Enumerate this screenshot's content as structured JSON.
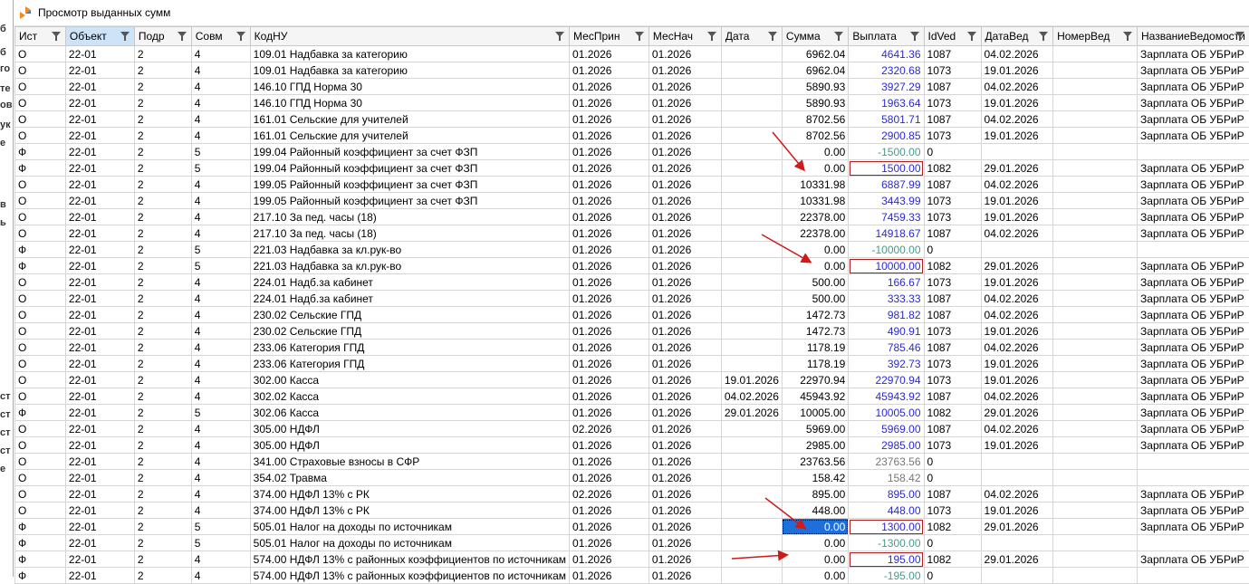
{
  "window": {
    "title": "Просмотр выданных сумм",
    "left_strip_letters": [
      "б",
      "б",
      "го",
      "те",
      "ов",
      "ук",
      "е",
      "в",
      "ь",
      "ст",
      "ст",
      "ст",
      "ст",
      "е"
    ]
  },
  "columns": [
    "Ист",
    "Объект",
    "Подр",
    "Совм",
    "КодНУ",
    "МесПрин",
    "МесНач",
    "Дата",
    "Сумма",
    "Выплата",
    "IdVed",
    "ДатаВед",
    "НомерВед",
    "НазваниеВедомости"
  ],
  "rows": [
    {
      "ist": "О",
      "obj": "22-01",
      "podr": "2",
      "sovm": "4",
      "kod": "109.01 Надбавка за категорию",
      "mesprin": "01.2026",
      "mesnach": "01.2026",
      "data": "",
      "summa": "6962.04",
      "vyplata": "4641.36",
      "idved": "1087",
      "dataved": "04.02.2026",
      "nomer": "",
      "nazv": "Зарплата ОБ УБРиР"
    },
    {
      "ist": "О",
      "obj": "22-01",
      "podr": "2",
      "sovm": "4",
      "kod": "109.01 Надбавка за категорию",
      "mesprin": "01.2026",
      "mesnach": "01.2026",
      "data": "",
      "summa": "6962.04",
      "vyplata": "2320.68",
      "idved": "1073",
      "dataved": "19.01.2026",
      "nomer": "",
      "nazv": "Зарплата ОБ УБРиР"
    },
    {
      "ist": "О",
      "obj": "22-01",
      "podr": "2",
      "sovm": "4",
      "kod": "146.10 ГПД Норма 30",
      "mesprin": "01.2026",
      "mesnach": "01.2026",
      "data": "",
      "summa": "5890.93",
      "vyplata": "3927.29",
      "idved": "1087",
      "dataved": "04.02.2026",
      "nomer": "",
      "nazv": "Зарплата ОБ УБРиР"
    },
    {
      "ist": "О",
      "obj": "22-01",
      "podr": "2",
      "sovm": "4",
      "kod": "146.10 ГПД Норма 30",
      "mesprin": "01.2026",
      "mesnach": "01.2026",
      "data": "",
      "summa": "5890.93",
      "vyplata": "1963.64",
      "idved": "1073",
      "dataved": "19.01.2026",
      "nomer": "",
      "nazv": "Зарплата ОБ УБРиР"
    },
    {
      "ist": "О",
      "obj": "22-01",
      "podr": "2",
      "sovm": "4",
      "kod": "161.01 Сельские для учителей",
      "mesprin": "01.2026",
      "mesnach": "01.2026",
      "data": "",
      "summa": "8702.56",
      "vyplata": "5801.71",
      "idved": "1087",
      "dataved": "04.02.2026",
      "nomer": "",
      "nazv": "Зарплата ОБ УБРиР"
    },
    {
      "ist": "О",
      "obj": "22-01",
      "podr": "2",
      "sovm": "4",
      "kod": "161.01 Сельские для учителей",
      "mesprin": "01.2026",
      "mesnach": "01.2026",
      "data": "",
      "summa": "8702.56",
      "vyplata": "2900.85",
      "idved": "1073",
      "dataved": "19.01.2026",
      "nomer": "",
      "nazv": "Зарплата ОБ УБРиР"
    },
    {
      "ist": "Ф",
      "obj": "22-01",
      "podr": "2",
      "sovm": "5",
      "kod": "199.04 Районный коэффициент за счет ФЗП",
      "mesprin": "01.2026",
      "mesnach": "01.2026",
      "data": "",
      "summa": "0.00",
      "vyplata": "-1500.00",
      "idved": "0",
      "dataved": "",
      "nomer": "",
      "nazv": "",
      "style": "neg"
    },
    {
      "ist": "Ф",
      "obj": "22-01",
      "podr": "2",
      "sovm": "5",
      "kod": "199.04 Районный коэффициент за счет ФЗП",
      "mesprin": "01.2026",
      "mesnach": "01.2026",
      "data": "",
      "summa": "0.00",
      "vyplata": "1500.00",
      "idved": "1082",
      "dataved": "29.01.2026",
      "nomer": "",
      "nazv": "Зарплата ОБ УБРиР",
      "style": "boxed"
    },
    {
      "ist": "О",
      "obj": "22-01",
      "podr": "2",
      "sovm": "4",
      "kod": "199.05 Районный коэффициент за счет ФЗП",
      "mesprin": "01.2026",
      "mesnach": "01.2026",
      "data": "",
      "summa": "10331.98",
      "vyplata": "6887.99",
      "idved": "1087",
      "dataved": "04.02.2026",
      "nomer": "",
      "nazv": "Зарплата ОБ УБРиР"
    },
    {
      "ist": "О",
      "obj": "22-01",
      "podr": "2",
      "sovm": "4",
      "kod": "199.05 Районный коэффициент за счет ФЗП",
      "mesprin": "01.2026",
      "mesnach": "01.2026",
      "data": "",
      "summa": "10331.98",
      "vyplata": "3443.99",
      "idved": "1073",
      "dataved": "19.01.2026",
      "nomer": "",
      "nazv": "Зарплата ОБ УБРиР"
    },
    {
      "ist": "О",
      "obj": "22-01",
      "podr": "2",
      "sovm": "4",
      "kod": "217.10 За пед. часы (18)",
      "mesprin": "01.2026",
      "mesnach": "01.2026",
      "data": "",
      "summa": "22378.00",
      "vyplata": "7459.33",
      "idved": "1073",
      "dataved": "19.01.2026",
      "nomer": "",
      "nazv": "Зарплата ОБ УБРиР"
    },
    {
      "ist": "О",
      "obj": "22-01",
      "podr": "2",
      "sovm": "4",
      "kod": "217.10 За пед. часы (18)",
      "mesprin": "01.2026",
      "mesnach": "01.2026",
      "data": "",
      "summa": "22378.00",
      "vyplata": "14918.67",
      "idved": "1087",
      "dataved": "04.02.2026",
      "nomer": "",
      "nazv": "Зарплата ОБ УБРиР"
    },
    {
      "ist": "Ф",
      "obj": "22-01",
      "podr": "2",
      "sovm": "5",
      "kod": "221.03 Надбавка за кл.рук-во",
      "mesprin": "01.2026",
      "mesnach": "01.2026",
      "data": "",
      "summa": "0.00",
      "vyplata": "-10000.00",
      "idved": "0",
      "dataved": "",
      "nomer": "",
      "nazv": "",
      "style": "neg"
    },
    {
      "ist": "Ф",
      "obj": "22-01",
      "podr": "2",
      "sovm": "5",
      "kod": "221.03 Надбавка за кл.рук-во",
      "mesprin": "01.2026",
      "mesnach": "01.2026",
      "data": "",
      "summa": "0.00",
      "vyplata": "10000.00",
      "idved": "1082",
      "dataved": "29.01.2026",
      "nomer": "",
      "nazv": "Зарплата ОБ УБРиР",
      "style": "boxed"
    },
    {
      "ist": "О",
      "obj": "22-01",
      "podr": "2",
      "sovm": "4",
      "kod": "224.01 Надб.за кабинет",
      "mesprin": "01.2026",
      "mesnach": "01.2026",
      "data": "",
      "summa": "500.00",
      "vyplata": "166.67",
      "idved": "1073",
      "dataved": "19.01.2026",
      "nomer": "",
      "nazv": "Зарплата ОБ УБРиР"
    },
    {
      "ist": "О",
      "obj": "22-01",
      "podr": "2",
      "sovm": "4",
      "kod": "224.01 Надб.за кабинет",
      "mesprin": "01.2026",
      "mesnach": "01.2026",
      "data": "",
      "summa": "500.00",
      "vyplata": "333.33",
      "idved": "1087",
      "dataved": "04.02.2026",
      "nomer": "",
      "nazv": "Зарплата ОБ УБРиР"
    },
    {
      "ist": "О",
      "obj": "22-01",
      "podr": "2",
      "sovm": "4",
      "kod": "230.02 Сельские ГПД",
      "mesprin": "01.2026",
      "mesnach": "01.2026",
      "data": "",
      "summa": "1472.73",
      "vyplata": "981.82",
      "idved": "1087",
      "dataved": "04.02.2026",
      "nomer": "",
      "nazv": "Зарплата ОБ УБРиР"
    },
    {
      "ist": "О",
      "obj": "22-01",
      "podr": "2",
      "sovm": "4",
      "kod": "230.02 Сельские ГПД",
      "mesprin": "01.2026",
      "mesnach": "01.2026",
      "data": "",
      "summa": "1472.73",
      "vyplata": "490.91",
      "idved": "1073",
      "dataved": "19.01.2026",
      "nomer": "",
      "nazv": "Зарплата ОБ УБРиР"
    },
    {
      "ist": "О",
      "obj": "22-01",
      "podr": "2",
      "sovm": "4",
      "kod": "233.06 Категория ГПД",
      "mesprin": "01.2026",
      "mesnach": "01.2026",
      "data": "",
      "summa": "1178.19",
      "vyplata": "785.46",
      "idved": "1087",
      "dataved": "04.02.2026",
      "nomer": "",
      "nazv": "Зарплата ОБ УБРиР"
    },
    {
      "ist": "О",
      "obj": "22-01",
      "podr": "2",
      "sovm": "4",
      "kod": "233.06 Категория ГПД",
      "mesprin": "01.2026",
      "mesnach": "01.2026",
      "data": "",
      "summa": "1178.19",
      "vyplata": "392.73",
      "idved": "1073",
      "dataved": "19.01.2026",
      "nomer": "",
      "nazv": "Зарплата ОБ УБРиР"
    },
    {
      "ist": "О",
      "obj": "22-01",
      "podr": "2",
      "sovm": "4",
      "kod": "302.00 Касса",
      "mesprin": "01.2026",
      "mesnach": "01.2026",
      "data": "19.01.2026",
      "summa": "22970.94",
      "vyplata": "22970.94",
      "idved": "1073",
      "dataved": "19.01.2026",
      "nomer": "",
      "nazv": "Зарплата ОБ УБРиР"
    },
    {
      "ist": "О",
      "obj": "22-01",
      "podr": "2",
      "sovm": "4",
      "kod": "302.02 Касса",
      "mesprin": "01.2026",
      "mesnach": "01.2026",
      "data": "04.02.2026",
      "summa": "45943.92",
      "vyplata": "45943.92",
      "idved": "1087",
      "dataved": "04.02.2026",
      "nomer": "",
      "nazv": "Зарплата ОБ УБРиР"
    },
    {
      "ist": "Ф",
      "obj": "22-01",
      "podr": "2",
      "sovm": "5",
      "kod": "302.06 Касса",
      "mesprin": "01.2026",
      "mesnach": "01.2026",
      "data": "29.01.2026",
      "summa": "10005.00",
      "vyplata": "10005.00",
      "idved": "1082",
      "dataved": "29.01.2026",
      "nomer": "",
      "nazv": "Зарплата ОБ УБРиР"
    },
    {
      "ist": "О",
      "obj": "22-01",
      "podr": "2",
      "sovm": "4",
      "kod": "305.00 НДФЛ",
      "mesprin": "02.2026",
      "mesnach": "01.2026",
      "data": "",
      "summa": "5969.00",
      "vyplata": "5969.00",
      "idved": "1087",
      "dataved": "04.02.2026",
      "nomer": "",
      "nazv": "Зарплата ОБ УБРиР"
    },
    {
      "ist": "О",
      "obj": "22-01",
      "podr": "2",
      "sovm": "4",
      "kod": "305.00 НДФЛ",
      "mesprin": "01.2026",
      "mesnach": "01.2026",
      "data": "",
      "summa": "2985.00",
      "vyplata": "2985.00",
      "idved": "1073",
      "dataved": "19.01.2026",
      "nomer": "",
      "nazv": "Зарплата ОБ УБРиР"
    },
    {
      "ist": "О",
      "obj": "22-01",
      "podr": "2",
      "sovm": "4",
      "kod": "341.00 Страховые взносы в СФР",
      "mesprin": "01.2026",
      "mesnach": "01.2026",
      "data": "",
      "summa": "23763.56",
      "vyplata": "23763.56",
      "idved": "0",
      "dataved": "",
      "nomer": "",
      "nazv": "",
      "style": "gray"
    },
    {
      "ist": "О",
      "obj": "22-01",
      "podr": "2",
      "sovm": "4",
      "kod": "354.02 Травма",
      "mesprin": "01.2026",
      "mesnach": "01.2026",
      "data": "",
      "summa": "158.42",
      "vyplata": "158.42",
      "idved": "0",
      "dataved": "",
      "nomer": "",
      "nazv": "",
      "style": "gray"
    },
    {
      "ist": "О",
      "obj": "22-01",
      "podr": "2",
      "sovm": "4",
      "kod": "374.00 НДФЛ 13% с РК",
      "mesprin": "02.2026",
      "mesnach": "01.2026",
      "data": "",
      "summa": "895.00",
      "vyplata": "895.00",
      "idved": "1087",
      "dataved": "04.02.2026",
      "nomer": "",
      "nazv": "Зарплата ОБ УБРиР"
    },
    {
      "ist": "О",
      "obj": "22-01",
      "podr": "2",
      "sovm": "4",
      "kod": "374.00 НДФЛ 13% с РК",
      "mesprin": "01.2026",
      "mesnach": "01.2026",
      "data": "",
      "summa": "448.00",
      "vyplata": "448.00",
      "idved": "1073",
      "dataved": "19.01.2026",
      "nomer": "",
      "nazv": "Зарплата ОБ УБРиР"
    },
    {
      "ist": "Ф",
      "obj": "22-01",
      "podr": "2",
      "sovm": "5",
      "kod": "505.01 Налог на доходы по источникам",
      "mesprin": "01.2026",
      "mesnach": "01.2026",
      "data": "",
      "summa": "0.00",
      "vyplata": "1300.00",
      "idved": "1082",
      "dataved": "29.01.2026",
      "nomer": "",
      "nazv": "Зарплата ОБ УБРиР",
      "style": "boxed",
      "selected": true
    },
    {
      "ist": "Ф",
      "obj": "22-01",
      "podr": "2",
      "sovm": "5",
      "kod": "505.01 Налог на доходы по источникам",
      "mesprin": "01.2026",
      "mesnach": "01.2026",
      "data": "",
      "summa": "0.00",
      "vyplata": "-1300.00",
      "idved": "0",
      "dataved": "",
      "nomer": "",
      "nazv": "",
      "style": "neg"
    },
    {
      "ist": "Ф",
      "obj": "22-01",
      "podr": "2",
      "sovm": "4",
      "kod": "574.00 НДФЛ 13% с районных коэффициентов по источникам",
      "mesprin": "01.2026",
      "mesnach": "01.2026",
      "data": "",
      "summa": "0.00",
      "vyplata": "195.00",
      "idved": "1082",
      "dataved": "29.01.2026",
      "nomer": "",
      "nazv": "Зарплата ОБ УБРиР",
      "style": "boxed"
    },
    {
      "ist": "Ф",
      "obj": "22-01",
      "podr": "2",
      "sovm": "4",
      "kod": "574.00 НДФЛ 13% с районных коэффициентов по источникам",
      "mesprin": "01.2026",
      "mesnach": "01.2026",
      "data": "",
      "summa": "0.00",
      "vyplata": "-195.00",
      "idved": "0",
      "dataved": "",
      "nomer": "",
      "nazv": "",
      "style": "neg"
    }
  ],
  "colors": {
    "payment_blue": "#2a2ad6",
    "negative_teal": "#4a9a8a",
    "highlight_box": "#b01c1c",
    "selection": "#1e6fd9",
    "active_header": "#cde3f7"
  }
}
